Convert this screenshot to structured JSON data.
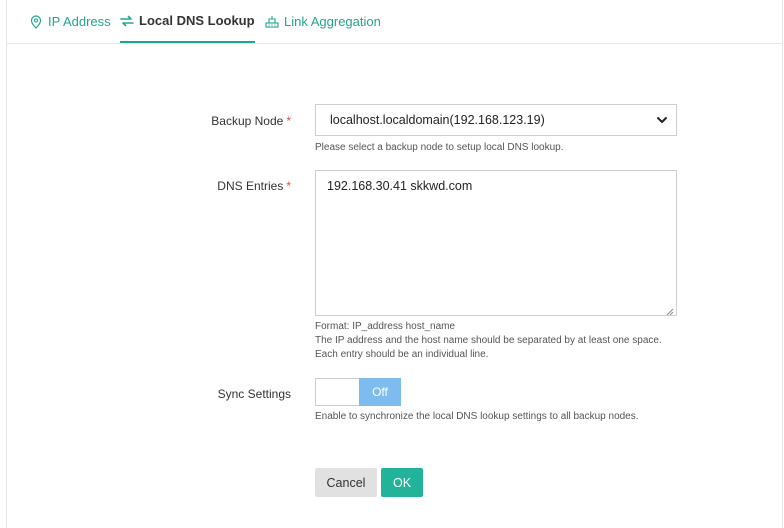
{
  "tabs": [
    {
      "label": "IP Address",
      "icon": "location-pin-icon"
    },
    {
      "label": "Local DNS Lookup",
      "icon": "swap-arrows-icon",
      "active": true
    },
    {
      "label": "Link Aggregation",
      "icon": "network-link-icon"
    }
  ],
  "form": {
    "backup_node": {
      "label": "Backup Node",
      "required_mark": "*",
      "value": "localhost.localdomain(192.168.123.19)",
      "hint": "Please select a backup node to setup local DNS lookup."
    },
    "dns_entries": {
      "label": "DNS Entries",
      "required_mark": "*",
      "value": "192.168.30.41 skkwd.com",
      "hints": [
        "Format: IP_address host_name",
        "The IP address and the host name should be separated by at least one space.",
        "Each entry should be an individual line."
      ]
    },
    "sync_settings": {
      "label": "Sync Settings",
      "toggle_state": "Off",
      "hint": "Enable to synchronize the local DNS lookup settings to all backup nodes."
    }
  },
  "buttons": {
    "cancel": "Cancel",
    "ok": "OK"
  },
  "colors": {
    "accent": "#22a58f",
    "ok_button": "#22b39a",
    "toggle_off": "#7ebcef",
    "required": "#e64545"
  }
}
